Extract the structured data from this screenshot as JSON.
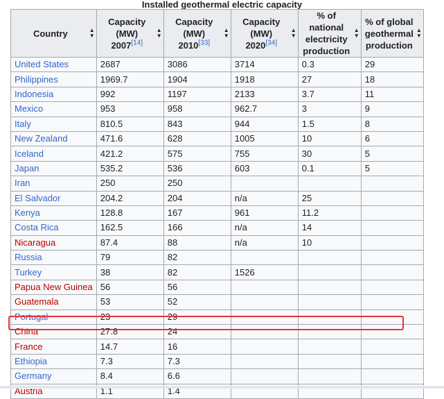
{
  "table": {
    "caption": "Installed geothermal electric capacity",
    "headers": [
      {
        "label": "Country",
        "ref": ""
      },
      {
        "label": "Capacity (MW) 2007",
        "ref": "[14]"
      },
      {
        "label": "Capacity (MW) 2010",
        "ref": "[33]"
      },
      {
        "label": "Capacity (MW) 2020",
        "ref": "[34]"
      },
      {
        "label": "% of national electricity production",
        "ref": ""
      },
      {
        "label": "% of global geothermal production",
        "ref": ""
      }
    ],
    "rows": [
      {
        "country": "United States",
        "link": "blue",
        "c2007": "2687",
        "c2010": "3086",
        "c2020": "3714",
        "national": "0.3",
        "global": "29"
      },
      {
        "country": "Philippines",
        "link": "blue",
        "c2007": "1969.7",
        "c2010": "1904",
        "c2020": "1918",
        "national": "27",
        "global": "18"
      },
      {
        "country": "Indonesia",
        "link": "blue",
        "c2007": "992",
        "c2010": "1197",
        "c2020": "2133",
        "national": "3.7",
        "global": "11"
      },
      {
        "country": "Mexico",
        "link": "blue",
        "c2007": "953",
        "c2010": "958",
        "c2020": "962.7",
        "national": "3",
        "global": "9"
      },
      {
        "country": "Italy",
        "link": "blue",
        "c2007": "810.5",
        "c2010": "843",
        "c2020": "944",
        "national": "1.5",
        "global": "8"
      },
      {
        "country": "New Zealand",
        "link": "blue",
        "c2007": "471.6",
        "c2010": "628",
        "c2020": "1005",
        "national": "10",
        "global": "6"
      },
      {
        "country": "Iceland",
        "link": "blue",
        "c2007": "421.2",
        "c2010": "575",
        "c2020": "755",
        "national": "30",
        "global": "5"
      },
      {
        "country": "Japan",
        "link": "blue",
        "c2007": "535.2",
        "c2010": "536",
        "c2020": "603",
        "national": "0.1",
        "global": "5"
      },
      {
        "country": "Iran",
        "link": "blue",
        "c2007": "250",
        "c2010": "250",
        "c2020": "",
        "national": "",
        "global": ""
      },
      {
        "country": "El Salvador",
        "link": "blue",
        "c2007": "204.2",
        "c2010": "204",
        "c2020": "n/a",
        "national": "25",
        "global": ""
      },
      {
        "country": "Kenya",
        "link": "blue",
        "c2007": "128.8",
        "c2010": "167",
        "c2020": "961",
        "national": "11.2",
        "global": ""
      },
      {
        "country": "Costa Rica",
        "link": "blue",
        "c2007": "162.5",
        "c2010": "166",
        "c2020": "n/a",
        "national": "14",
        "global": ""
      },
      {
        "country": "Nicaragua",
        "link": "red",
        "c2007": "87.4",
        "c2010": "88",
        "c2020": "n/a",
        "national": "10",
        "global": ""
      },
      {
        "country": "Russia",
        "link": "blue",
        "c2007": "79",
        "c2010": "82",
        "c2020": "",
        "national": "",
        "global": ""
      },
      {
        "country": "Turkey",
        "link": "blue",
        "c2007": "38",
        "c2010": "82",
        "c2020": "1526",
        "national": "",
        "global": ""
      },
      {
        "country": "Papua New Guinea",
        "link": "red",
        "c2007": "56",
        "c2010": "56",
        "c2020": "",
        "national": "",
        "global": ""
      },
      {
        "country": "Guatemala",
        "link": "red",
        "c2007": "53",
        "c2010": "52",
        "c2020": "",
        "national": "",
        "global": ""
      },
      {
        "country": "Portugal",
        "link": "blue",
        "c2007": "23",
        "c2010": "29",
        "c2020": "",
        "national": "",
        "global": ""
      },
      {
        "country": "China",
        "link": "red",
        "c2007": "27.8",
        "c2010": "24",
        "c2020": "",
        "national": "",
        "global": ""
      },
      {
        "country": "France",
        "link": "red",
        "c2007": "14.7",
        "c2010": "16",
        "c2020": "",
        "national": "",
        "global": ""
      },
      {
        "country": "Ethiopia",
        "link": "blue",
        "c2007": "7.3",
        "c2010": "7.3",
        "c2020": "",
        "national": "",
        "global": ""
      },
      {
        "country": "Germany",
        "link": "blue",
        "c2007": "8.4",
        "c2010": "6.6",
        "c2020": "",
        "national": "",
        "global": ""
      },
      {
        "country": "Austria",
        "link": "red",
        "c2007": "1.1",
        "c2010": "1.4",
        "c2020": "",
        "national": "",
        "global": ""
      }
    ],
    "highlighted_row": "China"
  },
  "colors": {
    "link_blue": "#3366cc",
    "link_red": "#ba0000",
    "header_bg": "#eaecf0",
    "cell_bg": "#f8f9fa",
    "border": "#a2a9b1",
    "highlight": "#e8333b"
  },
  "icons": {
    "sort": "sort-arrows-icon"
  }
}
